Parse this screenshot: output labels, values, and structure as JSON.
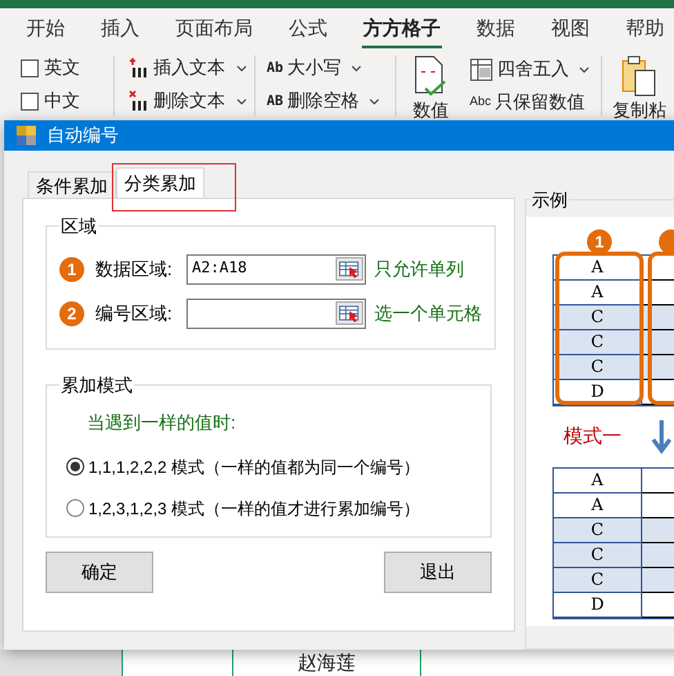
{
  "ribbon": {
    "tabs": [
      {
        "label": "开始",
        "selected": false
      },
      {
        "label": "插入",
        "selected": false
      },
      {
        "label": "页面布局",
        "selected": false
      },
      {
        "label": "公式",
        "selected": false
      },
      {
        "label": "方方格子",
        "selected": true
      },
      {
        "label": "数据",
        "selected": false
      },
      {
        "label": "视图",
        "selected": false
      },
      {
        "label": "帮助",
        "selected": false
      }
    ],
    "checkboxes": [
      {
        "label": "英文",
        "checked": false
      },
      {
        "label": "中文",
        "checked": false
      }
    ],
    "text_tools": [
      {
        "label": "插入文本",
        "kind": "insert"
      },
      {
        "label": "删除文本",
        "kind": "delete"
      }
    ],
    "case_tools": [
      {
        "icon_text": "Ab",
        "label": "大小写"
      },
      {
        "icon_text": "AB",
        "label": "删除空格"
      }
    ],
    "value_button": "数值",
    "number_tools": [
      {
        "kind": "round",
        "label": "四舍五入"
      },
      {
        "kind": "abc",
        "icon_text": "Abc",
        "label": "只保留数值"
      }
    ],
    "paste_button": "复制粘"
  },
  "dialog": {
    "title": "自动编号",
    "tabs": [
      {
        "label": "条件累加",
        "selected": false
      },
      {
        "label": "分类累加",
        "selected": true
      }
    ],
    "region": {
      "title": "区域",
      "fields": [
        {
          "number": "1",
          "label": "数据区域:",
          "value": "A2:A18",
          "hint": "只允许单列"
        },
        {
          "number": "2",
          "label": "编号区域:",
          "hint": "选一个单元格"
        }
      ]
    },
    "mode": {
      "title": "累加模式",
      "prompt": "当遇到一样的值时:",
      "options": [
        {
          "label": "1,1,1,2,2,2 模式（一样的值都为同一个编号）",
          "selected": true
        },
        {
          "label": "1,2,3,1,2,3 模式（一样的值才进行累加编号）",
          "selected": false
        }
      ]
    },
    "buttons": [
      "确定",
      "退出"
    ],
    "example": {
      "title": "示例",
      "badge": "1",
      "caption": "模式一",
      "before": [
        {
          "value": "A",
          "shaded": false
        },
        {
          "value": "A",
          "shaded": false
        },
        {
          "value": "C",
          "shaded": true
        },
        {
          "value": "C",
          "shaded": true
        },
        {
          "value": "C",
          "shaded": true
        },
        {
          "value": "D",
          "shaded": false
        }
      ],
      "after": [
        {
          "value": "A",
          "shaded": false
        },
        {
          "value": "A",
          "shaded": false
        },
        {
          "value": "C",
          "shaded": true
        },
        {
          "value": "C",
          "shaded": true
        },
        {
          "value": "C",
          "shaded": true
        },
        {
          "value": "D",
          "shaded": false
        }
      ]
    }
  },
  "sheet": {
    "cells": [
      "赵海莲"
    ]
  }
}
